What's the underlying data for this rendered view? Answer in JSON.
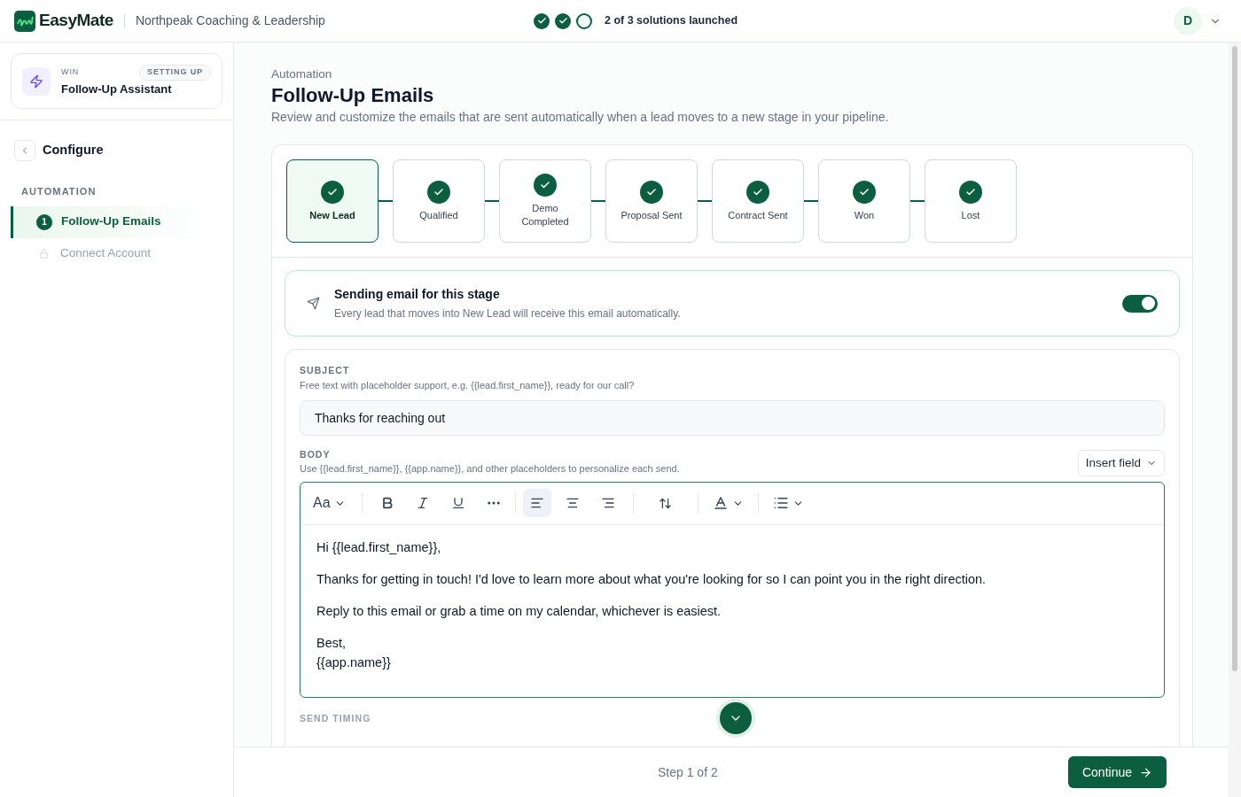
{
  "header": {
    "brand": "EasyMate",
    "org": "Northpeak Coaching & Leadership",
    "progress": [
      {
        "done": true
      },
      {
        "done": true
      },
      {
        "done": false
      }
    ],
    "progress_label": "2 of 3 solutions launched",
    "avatar": "D"
  },
  "sidebar": {
    "card": {
      "eyebrow": "WIN",
      "badge": "SETTING UP",
      "title": "Follow-Up Assistant"
    },
    "section_title": "Configure",
    "group": "AUTOMATION",
    "items": [
      {
        "kind": "step",
        "number": "1",
        "label": "Follow-Up Emails",
        "selected": true
      },
      {
        "kind": "locked",
        "label": "Connect Account",
        "selected": false
      }
    ]
  },
  "main": {
    "breadcrumb": "Automation",
    "title": "Follow-Up Emails",
    "subtitle": "Review and customize the emails that are sent automatically when a lead moves to a new stage in your pipeline.",
    "stages": [
      {
        "label": "New Lead",
        "done": true,
        "selected": true
      },
      {
        "label": "Qualified",
        "done": true,
        "selected": false
      },
      {
        "label": "Demo Completed",
        "done": true,
        "selected": false
      },
      {
        "label": "Proposal Sent",
        "done": true,
        "selected": false
      },
      {
        "label": "Contract Sent",
        "done": true,
        "selected": false
      },
      {
        "label": "Won",
        "done": true,
        "selected": false
      },
      {
        "label": "Lost",
        "done": true,
        "selected": false
      }
    ],
    "sending": {
      "title": "Sending email for this stage",
      "description": "Every lead that moves into New Lead will receive this email automatically.",
      "on": true
    },
    "subject": {
      "label": "SUBJECT",
      "hint": "Free text with placeholder support, e.g. {{lead.first_name}}, ready for our call?",
      "value": "Thanks for reaching out"
    },
    "body": {
      "label": "BODY",
      "hint": "Use {{lead.first_name}}, {{app.name}}, and other placeholders to personalize each send.",
      "insert_button": "Insert field",
      "font_button": "Aa",
      "alignment": [
        {
          "kind": "left",
          "selected": true
        },
        {
          "kind": "center",
          "selected": false
        },
        {
          "kind": "right",
          "selected": false
        }
      ],
      "paragraphs": [
        [
          "Hi {{lead.first_name}},"
        ],
        [
          "Thanks for getting in touch! I'd love to learn more about what you're looking for so I can point you in the right direction."
        ],
        [
          "Reply to this email or grab a time on my calendar, whichever is easiest."
        ],
        [
          "Best,",
          "{{app.name}}"
        ]
      ]
    },
    "next_section": "SEND TIMING"
  },
  "footer": {
    "step": "Step 1 of 2",
    "continue": "Continue"
  }
}
